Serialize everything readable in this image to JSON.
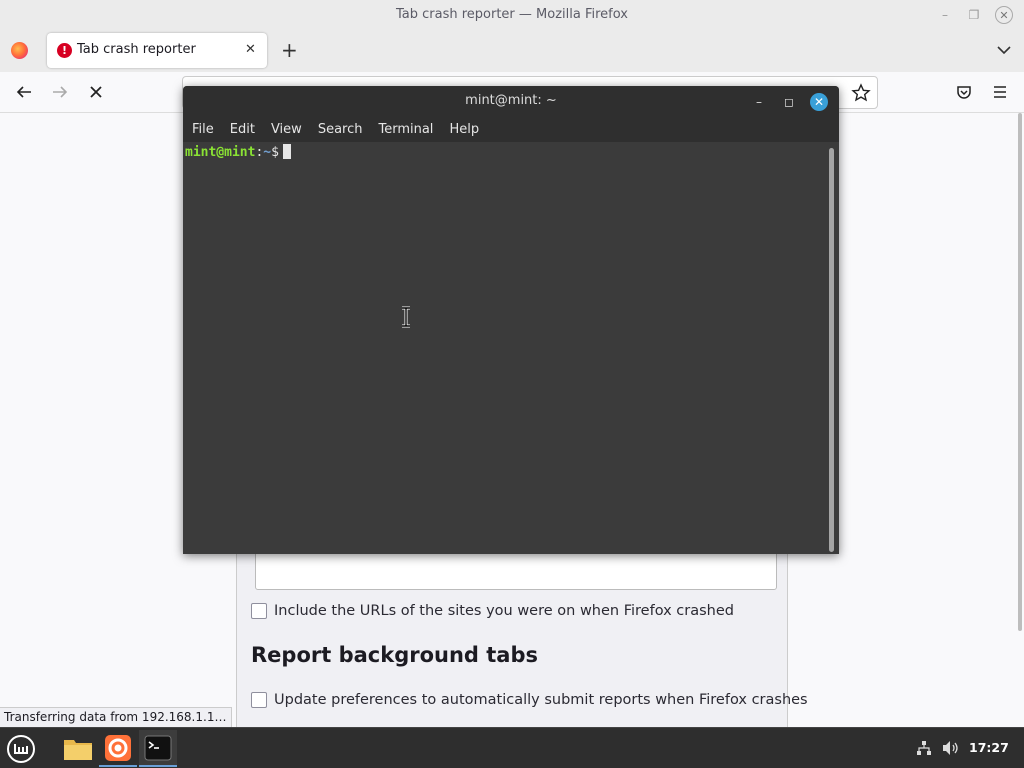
{
  "window": {
    "title": "Tab crash reporter — Mozilla Firefox"
  },
  "tabs": [
    {
      "label": "Tab crash reporter",
      "icon": "alert-icon"
    }
  ],
  "page": {
    "checkbox_urls": "Include the URLs of the sites you were on when Firefox crashed",
    "heading": "Report background tabs",
    "checkbox_prefs": "Update preferences to automatically submit reports when Firefox crashes"
  },
  "status_bar": "Transferring data from 192.168.1.1…",
  "terminal": {
    "title": "mint@mint: ~",
    "menu": [
      "File",
      "Edit",
      "View",
      "Search",
      "Terminal",
      "Help"
    ],
    "prompt_user": "mint@mint",
    "prompt_sep": ":",
    "prompt_path": "~",
    "prompt_symbol": "$"
  },
  "taskbar": {
    "clock": "17:27"
  },
  "colors": {
    "accent": "#39a0d8",
    "prompt_green": "#8ae234",
    "prompt_blue": "#729fcf"
  }
}
